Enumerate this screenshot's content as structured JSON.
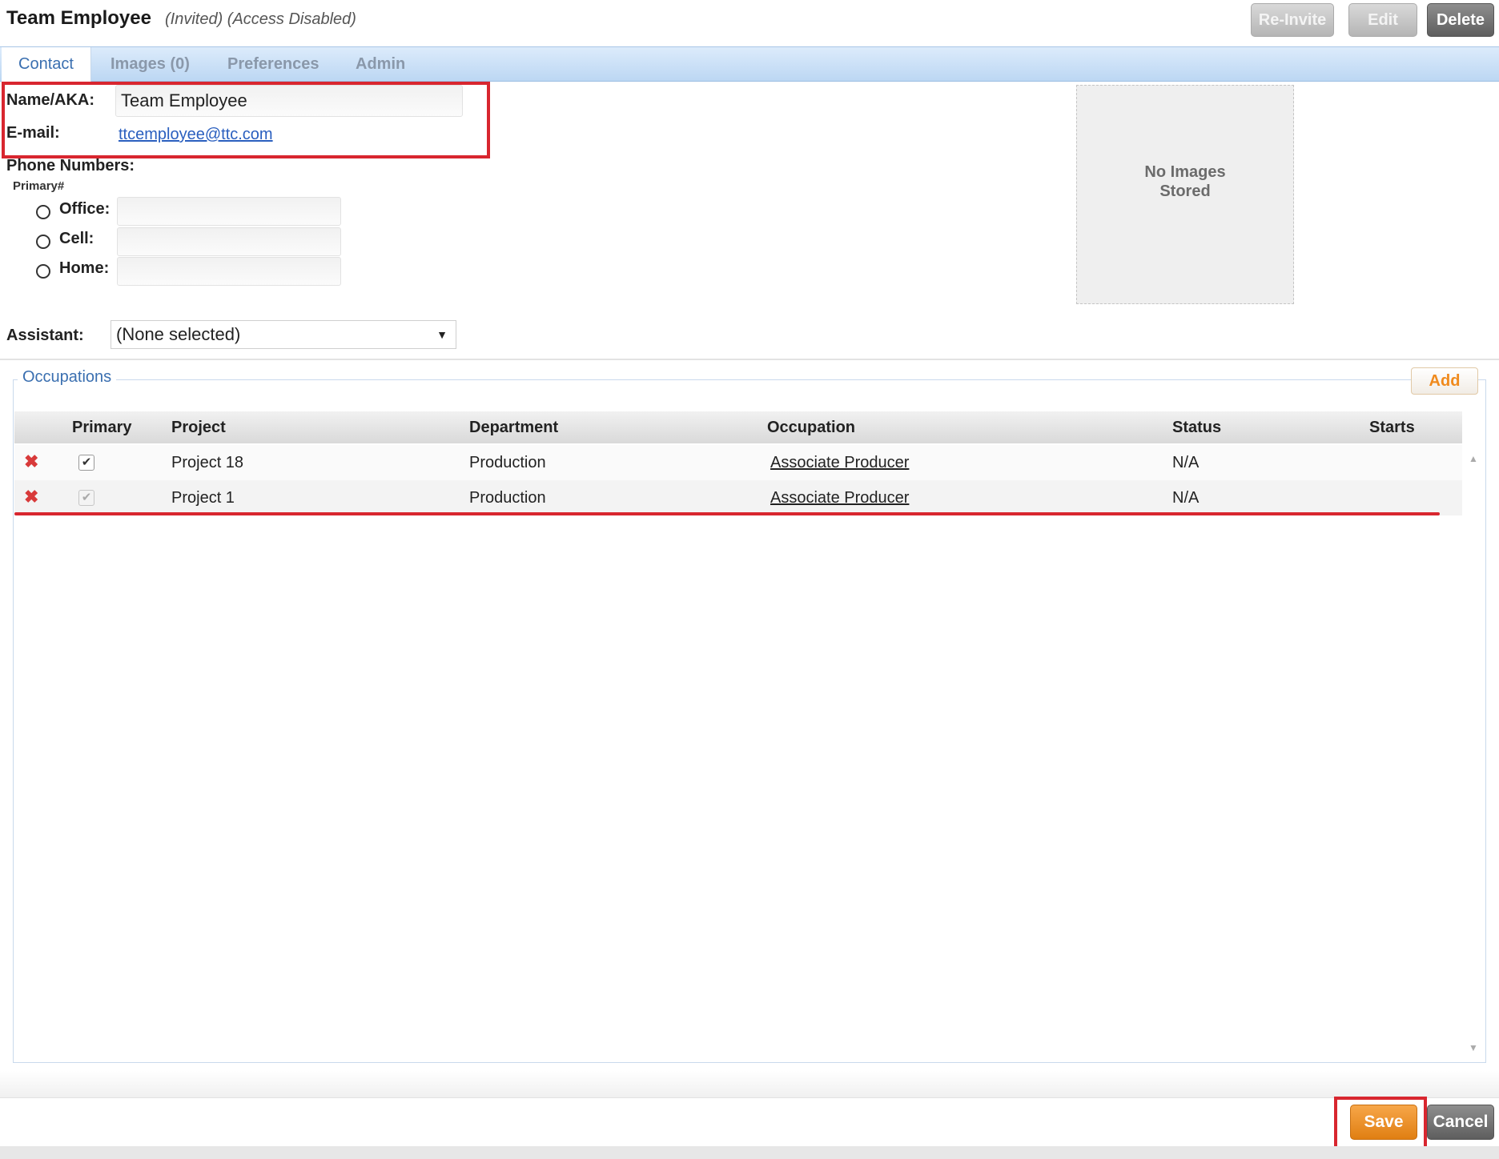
{
  "header": {
    "title": "Team Employee",
    "status": "(Invited) (Access Disabled)",
    "buttons": {
      "reinvite": "Re-Invite",
      "edit": "Edit",
      "delete": "Delete"
    }
  },
  "tabs": [
    {
      "label": "Contact"
    },
    {
      "label": "Images (0)"
    },
    {
      "label": "Preferences"
    },
    {
      "label": "Admin"
    }
  ],
  "contact": {
    "name_label": "Name/AKA:",
    "name_value": "Team Employee",
    "email_label": "E-mail:",
    "email_value": "ttcemployee@ttc.com",
    "phone_numbers_label": "Phone Numbers:",
    "primary_label": "Primary#",
    "phones": [
      {
        "label": "Office:",
        "value": ""
      },
      {
        "label": "Cell:",
        "value": ""
      },
      {
        "label": "Home:",
        "value": ""
      }
    ],
    "assistant_label": "Assistant:",
    "assistant_value": "(None selected)"
  },
  "images": {
    "placeholder_line1": "No Images",
    "placeholder_line2": "Stored"
  },
  "occupations": {
    "legend": "Occupations",
    "add_label": "Add",
    "columns": [
      "Primary",
      "Project",
      "Department",
      "Occupation",
      "Status",
      "Starts"
    ],
    "rows": [
      {
        "primary": true,
        "project": "Project 18",
        "department": "Production",
        "occupation": "Associate Producer",
        "status": "N/A",
        "starts": ""
      },
      {
        "primary": true,
        "project": "Project 1",
        "department": "Production",
        "occupation": "Associate Producer",
        "status": "N/A",
        "starts": ""
      }
    ]
  },
  "footer": {
    "save": "Save",
    "cancel": "Cancel"
  },
  "colors": {
    "highlight": "#d8262f",
    "accent": "#f08a1c",
    "link": "#2a5fbf"
  }
}
